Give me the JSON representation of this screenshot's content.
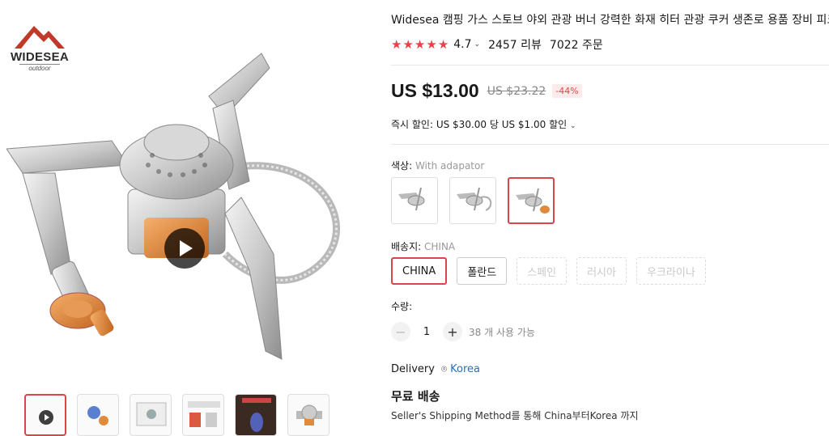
{
  "logo": {
    "name": "WIDESEA",
    "sub": "outdoor"
  },
  "gallery": {
    "thumbnails": [
      "video",
      "image-2",
      "image-3",
      "image-4",
      "image-5",
      "image-6"
    ]
  },
  "product": {
    "title": "Widesea 캠핑 가스 스토브 야외 관광 버너 강력한 화재 히터 관광 쿠커 생존로 용품 장비 피크닉",
    "rating": "4.7",
    "rating_value": 4.7,
    "reviews": "2457 리뷰",
    "orders": "7022 주문",
    "price": "US $13.00",
    "old_price": "US $23.22",
    "discount": "-44%",
    "instant_discount": "즉시 할인: US $30.00 당 US $1.00 할인"
  },
  "color": {
    "label": "색상:",
    "selected": "With adapator",
    "options": [
      "option-1",
      "option-2",
      "option-3"
    ],
    "active_index": 2
  },
  "ship_from": {
    "label": "배송지:",
    "selected": "CHINA",
    "options": [
      "CHINA",
      "폴란드",
      "스페인",
      "러시아",
      "우크라이나"
    ]
  },
  "quantity": {
    "label": "수량:",
    "minus": "−",
    "value": "1",
    "plus": "+",
    "stock": "38 개 사용 가능"
  },
  "delivery": {
    "label": "Delivery",
    "country": "Korea",
    "free_shipping": "무료 배송",
    "method": "Seller's Shipping Method를 통해 China부터Korea 까지"
  },
  "colors": {
    "accent": "#e8434a",
    "link": "#2a6ebb",
    "text": "#191919",
    "muted": "#999999"
  }
}
